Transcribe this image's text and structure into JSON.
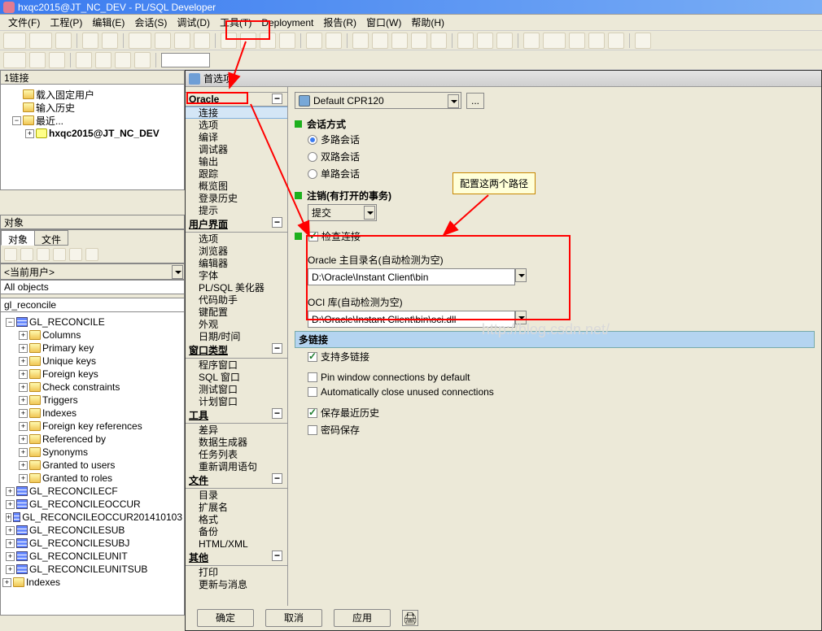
{
  "window": {
    "title": "hxqc2015@JT_NC_DEV - PL/SQL Developer"
  },
  "menu": {
    "file": "文件(F)",
    "project": "工程(P)",
    "edit": "编辑(E)",
    "session": "会话(S)",
    "debug": "调试(D)",
    "tools": "工具(T)",
    "deployment": "Deployment",
    "report": "报告(R)",
    "window": "窗口(W)",
    "help": "帮助(H)"
  },
  "toolbar2": {
    "dropdown": ""
  },
  "left": {
    "links_title": "1链接",
    "links_items": {
      "fixed_users": "载入固定用户",
      "history": "输入历史",
      "recent": "最近..."
    },
    "recent_conn": "hxqc2015@JT_NC_DEV",
    "objects_title": "对象",
    "tabs": {
      "objects": "对象",
      "files": "文件"
    },
    "current_user_label": "<当前用户>",
    "all_objects": "All objects",
    "filter": "gl_reconcile",
    "tree": {
      "root": "GL_RECONCILE",
      "sub": {
        "columns": "Columns",
        "pk": "Primary key",
        "uk": "Unique keys",
        "fk": "Foreign keys",
        "cc": "Check constraints",
        "trg": "Triggers",
        "idx": "Indexes",
        "fkr": "Foreign key references",
        "ref": "Referenced by",
        "syn": "Synonyms",
        "gtu": "Granted to users",
        "gtr": "Granted to roles"
      },
      "siblings": {
        "cf": "GL_RECONCILECF",
        "eo": "GL_RECONCILEOCCUR",
        "eo2": "GL_RECONCILEOCCUR201410103",
        "sub": "GL_RECONCILESUB",
        "subj": "GL_RECONCILESUBJ",
        "unit": "GL_RECONCILEUNIT",
        "usub": "GL_RECONCILEUNITSUB"
      },
      "indexes": "Indexes"
    }
  },
  "dlg": {
    "title": "首选项",
    "profile": "Default CPR120",
    "ellipsis": "...",
    "cats": {
      "oracle": "Oracle",
      "oracle_items": {
        "conn": "连接",
        "opts": "选项",
        "comp": "编译",
        "dbg": "调试器",
        "out": "输出",
        "trc": "跟踪",
        "prof": "概览图",
        "login": "登录历史",
        "hints": "提示"
      },
      "ui": "用户界面",
      "ui_items": {
        "opts2": "选项",
        "browser": "浏览器",
        "editor": "编辑器",
        "font": "字体",
        "plsql": "PL/SQL 美化器",
        "codeass": "代码助手",
        "kb": "键配置",
        "appear": "外观",
        "datetime": "日期/时间"
      },
      "wintype": "窗口类型",
      "wintype_items": {
        "prog": "程序窗口",
        "sql": "SQL 窗口",
        "test": "测试窗口",
        "plan": "计划窗口"
      },
      "tools": "工具",
      "tools_items": {
        "diff": "差异",
        "datagen": "数据生成器",
        "task": "任务列表",
        "recall": "重新调用语句"
      },
      "files": "文件",
      "files_items": {
        "dir": "目录",
        "ext": "扩展名",
        "fmt": "格式",
        "bak": "备份",
        "html": "HTML/XML"
      },
      "other": "其他",
      "other_items": {
        "print": "打印",
        "update": "更新与消息"
      }
    },
    "sections": {
      "session": "会话方式",
      "sess_opts": {
        "multi": "多路会话",
        "dual": "双路会话",
        "single": "单路会话"
      },
      "logoff": "注销(有打开的事务)",
      "logoff_value": "提交",
      "check": "检查连接",
      "home_label": "Oracle 主目录名(自动检测为空)",
      "home_value": "D:\\Oracle\\Instant Client\\bin",
      "oci_label": "OCI 库(自动检测为空)",
      "oci_value": "D:\\Oracle\\Instant Client\\bin\\oci.dll",
      "multiconn_hdr": "多链接",
      "support_multi": "支持多链接",
      "pin": "Pin window connections by default",
      "autoclose": "Automatically close unused connections",
      "save_recent": "保存最近历史",
      "save_pwd": "密码保存"
    },
    "buttons": {
      "ok": "确定",
      "cancel": "取消",
      "apply": "应用"
    }
  },
  "annotations": {
    "callout": "配置这两个路径"
  },
  "watermark": "http://blog.csdn.net/"
}
